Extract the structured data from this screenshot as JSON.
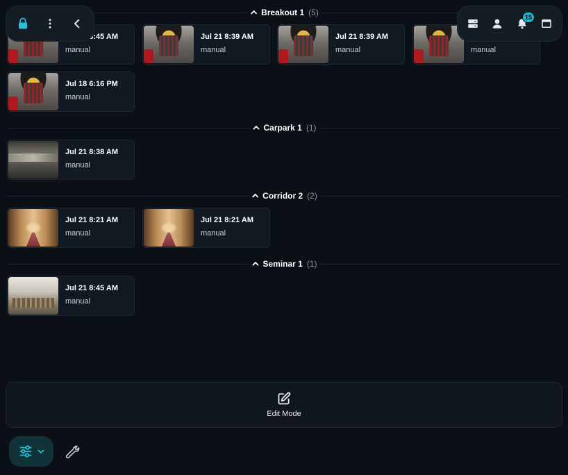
{
  "sections": [
    {
      "name": "Breakout 1",
      "count": "(5)",
      "cards": [
        {
          "date": "Jul 21 8:45 AM",
          "type": "manual",
          "thumb": "breakout"
        },
        {
          "date": "Jul 21 8:39 AM",
          "type": "manual",
          "thumb": "breakout"
        },
        {
          "date": "Jul 21 8:39 AM",
          "type": "manual",
          "thumb": "breakout"
        },
        {
          "date": "",
          "type": "manual",
          "thumb": "breakout"
        },
        {
          "date": "Jul 18 6:16 PM",
          "type": "manual",
          "thumb": "breakout"
        }
      ]
    },
    {
      "name": "Carpark 1",
      "count": "(1)",
      "cards": [
        {
          "date": "Jul 21 8:38 AM",
          "type": "manual",
          "thumb": "carpark"
        }
      ]
    },
    {
      "name": "Corridor 2",
      "count": "(2)",
      "cards": [
        {
          "date": "Jul 21 8:21 AM",
          "type": "manual",
          "thumb": "corridor"
        },
        {
          "date": "Jul 21 8:21 AM",
          "type": "manual",
          "thumb": "corridor"
        }
      ]
    },
    {
      "name": "Seminar 1",
      "count": "(1)",
      "cards": [
        {
          "date": "Jul 21 8:45 AM",
          "type": "manual",
          "thumb": "seminar"
        }
      ]
    }
  ],
  "top_left_toolbar": {
    "icons": [
      "lock-icon",
      "more-vertical-icon",
      "chevron-left-icon"
    ]
  },
  "top_right_toolbar": {
    "icons": [
      "server-icon",
      "user-icon",
      "bell-icon",
      "card-icon"
    ],
    "notification_count": "15"
  },
  "edit_mode": {
    "label": "Edit Mode",
    "icon": "edit-icon"
  },
  "bottom_toolbar": {
    "icons": [
      "sliders-icon",
      "chevron-down-icon",
      "wrench-icon"
    ]
  },
  "colors": {
    "background": "#0b1016",
    "card": "#111a22",
    "accent": "#1fb5c9",
    "lock": "#27c2d6",
    "filter_button": "#103238"
  }
}
